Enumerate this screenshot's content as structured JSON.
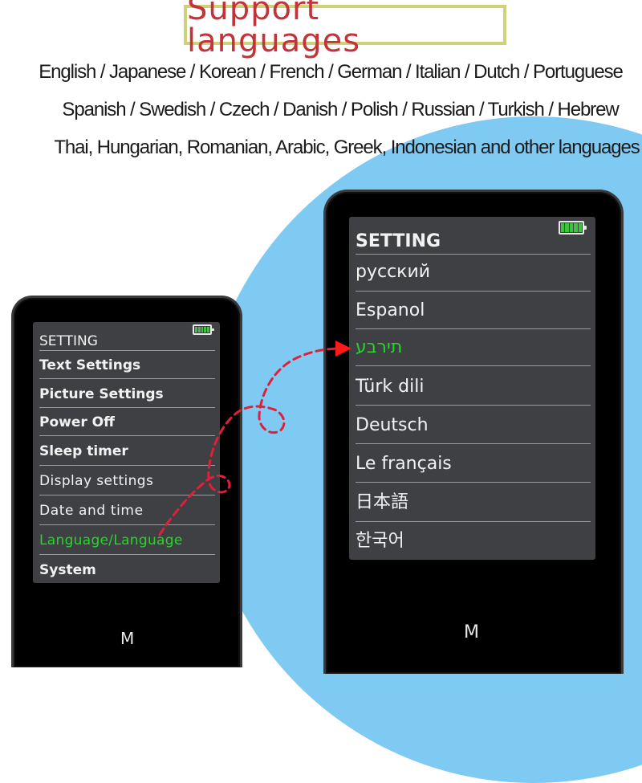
{
  "header": {
    "title": "Support languages",
    "language_lines": [
      "English / Japanese / Korean / French / German / Italian / Dutch / Portuguese",
      "Spanish / Swedish / Czech / Danish / Polish / Russian / Turkish / Hebrew",
      "Thai, Hungarian, Romanian, Arabic, Greek, Indonesian and other languages"
    ]
  },
  "colors": {
    "title_text": "#c0343a",
    "title_border": "#cfd27a",
    "background_circle": "#7fcaf2",
    "screen": "#3e4044",
    "highlight": "#28d528",
    "arrow": "#e0203a"
  },
  "left_device": {
    "screen_title": "SETTING",
    "battery_icon": "battery-full-icon",
    "menu_items": [
      {
        "label": "Text Settings",
        "active": false
      },
      {
        "label": "Picture Settings",
        "active": false
      },
      {
        "label": "Power Off",
        "active": false
      },
      {
        "label": "Sleep timer",
        "active": false
      },
      {
        "label": "Display settings",
        "active": false
      },
      {
        "label": "Date and time",
        "active": false
      },
      {
        "label": "Language/Language",
        "active": true
      },
      {
        "label": "System",
        "active": false
      }
    ],
    "button_label": "M"
  },
  "right_device": {
    "screen_title": "SETTING",
    "battery_icon": "battery-full-icon",
    "menu_items": [
      {
        "label": "русский",
        "active": false
      },
      {
        "label": "Espanol",
        "active": false
      },
      {
        "label": "תירבע",
        "active": true
      },
      {
        "label": "Türk dili",
        "active": false
      },
      {
        "label": "Deutsch",
        "active": false
      },
      {
        "label": "Le français",
        "active": false
      },
      {
        "label": "日本語",
        "active": false
      },
      {
        "label": "한국어",
        "active": false
      }
    ],
    "button_label": "M"
  },
  "connector": {
    "style": "dashed-curve-with-loops",
    "icon": "arrow-right-icon"
  }
}
